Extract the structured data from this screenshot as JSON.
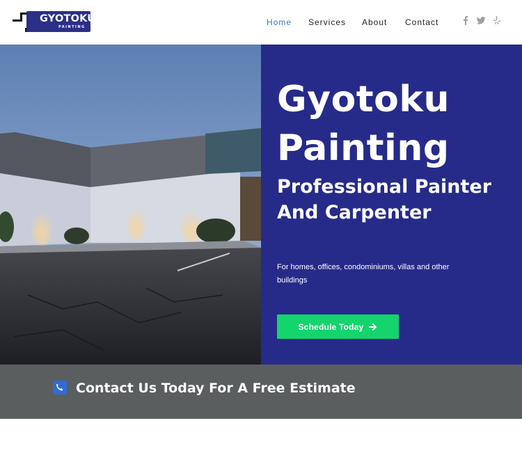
{
  "brand": {
    "name": "GYOTOKU",
    "tagline": "PAINTING",
    "brand_color": "#2b2f86"
  },
  "nav": {
    "items": [
      {
        "label": "Home",
        "active": true
      },
      {
        "label": "Services",
        "active": false
      },
      {
        "label": "About",
        "active": false
      },
      {
        "label": "Contact",
        "active": false
      }
    ],
    "active_color": "#3c78c6"
  },
  "social": {
    "icons": [
      "facebook-icon",
      "twitter-icon",
      "yelp-icon"
    ]
  },
  "hero": {
    "title": "Gyotoku Painting",
    "subtitle": "Professional Painter And Carpenter",
    "description": "For homes, offices, condominiums, villas and other buildings",
    "cta_label": "Schedule Today",
    "panel_color": "#262b8a",
    "cta_color": "#14d46c"
  },
  "contact_bar": {
    "text": "Contact Us Today For A Free Estimate",
    "background": "#5a5e5e",
    "icon": "phone-icon",
    "icon_color": "#2f6bd6"
  }
}
